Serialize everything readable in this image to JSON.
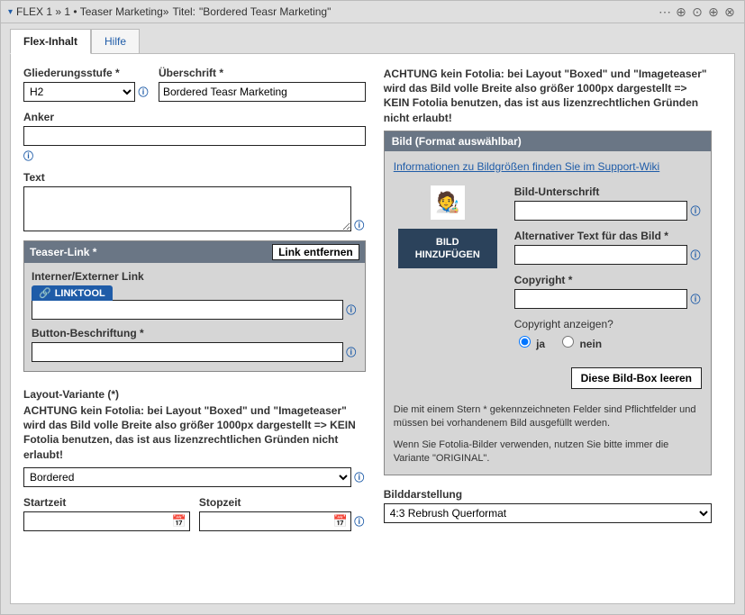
{
  "titlebar": {
    "prefix": "FLEX 1 »  1 • Teaser Marketing»",
    "title_label": "Titel:",
    "title_value": "\"Bordered Teasr Marketing\""
  },
  "tabs": {
    "content": "Flex-Inhalt",
    "help": "Hilfe"
  },
  "left": {
    "gliederung_label": "Gliederungsstufe *",
    "gliederung_value": "H2",
    "ueberschrift_label": "Überschrift *",
    "ueberschrift_value": "Bordered Teasr Marketing",
    "anker_label": "Anker",
    "anker_value": "",
    "text_label": "Text",
    "text_value": "",
    "teaser_link_label": "Teaser-Link *",
    "link_entfernen": "Link entfernen",
    "intern_extern_label": "Interner/Externer Link",
    "linktool": "LINKTOOL",
    "intern_extern_value": "",
    "button_beschriftung_label": "Button-Beschriftung *",
    "button_beschriftung_value": "",
    "layout_label": "Layout-Variante (*)",
    "layout_warning": "ACHTUNG kein Fotolia: bei Layout \"Boxed\" und \"Imageteaser\" wird das Bild volle Breite also größer 1000px dargestellt => KEIN Fotolia benutzen, das ist aus lizenzrechtlichen Gründen nicht erlaubt!",
    "layout_value": "Bordered",
    "startzeit_label": "Startzeit",
    "startzeit_value": "",
    "stopzeit_label": "Stopzeit",
    "stopzeit_value": ""
  },
  "right": {
    "top_warning": "ACHTUNG kein Fotolia: bei Layout \"Boxed\" und \"Imageteaser\" wird das Bild volle Breite also größer 1000px dargestellt => KEIN Fotolia benutzen, das ist aus lizenzrechtlichen Gründen nicht erlaubt!",
    "panel_title": "Bild (Format auswählbar)",
    "support_link": "Informationen zu Bildgrößen finden Sie im Support-Wiki",
    "add_image_btn": "BILD HINZUFÜGEN",
    "bild_unterschrift_label": "Bild-Unterschrift",
    "bild_unterschrift_value": "",
    "alt_text_label": "Alternativer Text für das Bild *",
    "alt_text_value": "",
    "copyright_label": "Copyright *",
    "copyright_value": "",
    "copyright_show_label": "Copyright anzeigen?",
    "opt_ja": "ja",
    "opt_nein": "nein",
    "clear_box_btn": "Diese Bild-Box leeren",
    "note1": "Die mit einem Stern * gekennzeichneten Felder sind Pflichtfelder und müssen bei vorhandenem Bild ausgefüllt werden.",
    "note2": "Wenn Sie Fotolia-Bilder verwenden, nutzen Sie bitte immer die Variante \"ORIGINAL\".",
    "bilddarstellung_label": "Bilddarstellung",
    "bilddarstellung_value": "4:3 Rebrush Querformat"
  }
}
